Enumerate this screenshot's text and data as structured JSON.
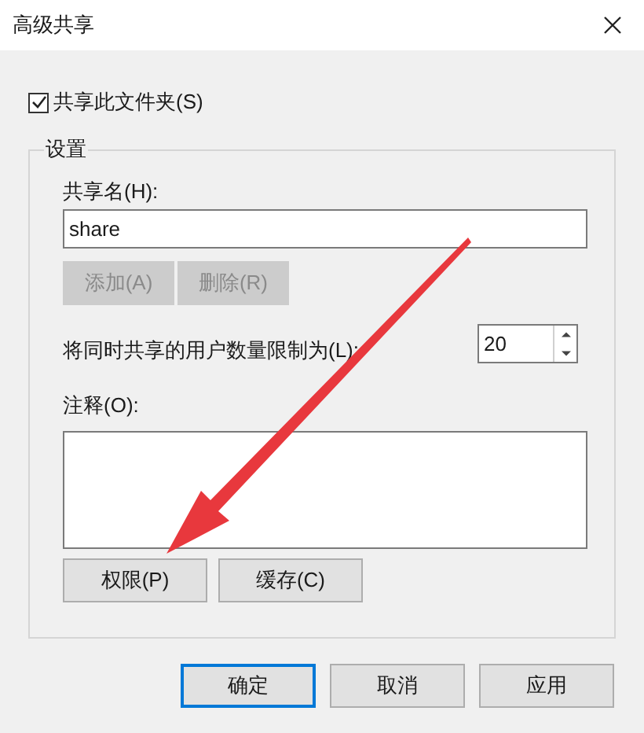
{
  "window": {
    "title": "高级共享"
  },
  "share_checkbox": {
    "label": "共享此文件夹(S)",
    "checked": true
  },
  "settings": {
    "title": "设置",
    "share_name": {
      "label": "共享名(H):",
      "value": "share"
    },
    "name_buttons": [
      {
        "label": "添加(A)",
        "disabled": true
      },
      {
        "label": "删除(R)",
        "disabled": true
      }
    ],
    "user_limit": {
      "label": "将同时共享的用户数量限制为(L):",
      "value": "20"
    },
    "comment": {
      "label": "注释(O):"
    },
    "buttons": [
      {
        "label": "权限(P)"
      },
      {
        "label": "缓存(C)"
      }
    ]
  },
  "dialog_buttons": [
    {
      "label": "确定",
      "default": true
    },
    {
      "label": "取消",
      "default": false
    },
    {
      "label": "应用",
      "default": false
    }
  ]
}
